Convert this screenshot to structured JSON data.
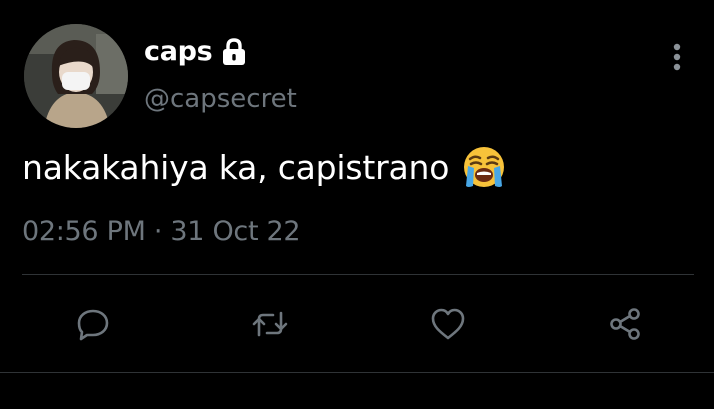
{
  "profile": {
    "display_name": "caps",
    "handle": "@capsecret",
    "avatar_icon": "profile-photo",
    "protected_icon": "lock-icon"
  },
  "tweet": {
    "text": "nakakahiya ka, capistrano",
    "emoji": "loudly-crying-face",
    "timestamp": "02:56 PM · 31 Oct 22"
  },
  "actions": [
    {
      "name": "reply",
      "icon": "comment-icon"
    },
    {
      "name": "retweet",
      "icon": "retweet-icon"
    },
    {
      "name": "like",
      "icon": "heart-icon"
    },
    {
      "name": "share",
      "icon": "share-icon"
    }
  ],
  "colors": {
    "background": "#000000",
    "text_primary": "#ffffff",
    "text_secondary": "#6e767d",
    "divider": "#2f3336",
    "icon": "#6e767d"
  }
}
